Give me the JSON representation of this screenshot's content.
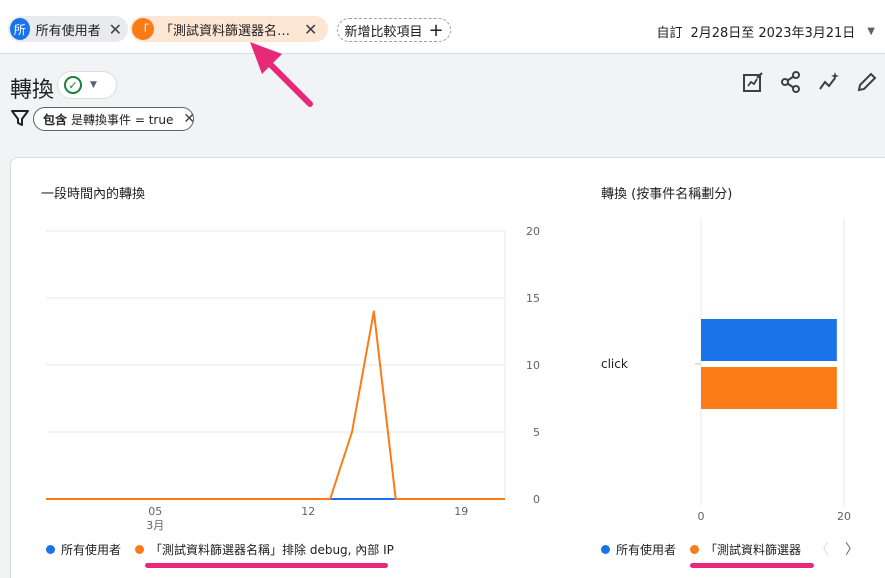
{
  "comparisons": [
    {
      "badge": "所",
      "label": "所有使用者",
      "color": "#1a73e8"
    },
    {
      "badge": "「",
      "label": "「測試資料篩選器名稱...",
      "color": "#fa7b17"
    }
  ],
  "add_comparison_label": "新增比較項目",
  "date": {
    "preset": "自訂",
    "range": "2月28日至 2023年3月21日"
  },
  "page": {
    "title": "轉換"
  },
  "filter": {
    "prefix": "包含",
    "text": "是轉換事件 = true"
  },
  "line_card": {
    "title": "一段時間內的轉換"
  },
  "bar_card": {
    "title": "轉換 (按事件名稱劃分)"
  },
  "legend_line": [
    "所有使用者",
    "「測試資料篩選器名稱」排除 debug, 內部 IP"
  ],
  "legend_bar": [
    "所有使用者",
    "「測試資料篩選器"
  ],
  "colors": {
    "series_blue": "#1a73e8",
    "series_orange": "#fa7b17",
    "annotation": "#e8297a"
  },
  "icons": [
    "customize-report-icon",
    "share-icon",
    "insights-icon",
    "edit-icon",
    "filter-icon",
    "check-circle-icon",
    "close-icon",
    "plus-icon",
    "chevron-right-icon",
    "chevron-left-icon"
  ],
  "chart_data": [
    {
      "type": "line",
      "title": "一段時間內的轉換",
      "x": [
        "2月28日",
        "3月1日",
        "3月2日",
        "3月3日",
        "3月4日",
        "3月5日",
        "3月6日",
        "3月7日",
        "3月8日",
        "3月9日",
        "3月10日",
        "3月11日",
        "3月12日",
        "3月13日",
        "3月14日",
        "3月15日",
        "3月16日",
        "3月17日",
        "3月18日",
        "3月19日",
        "3月20日",
        "3月21日"
      ],
      "x_ticks": [
        {
          "label": "05",
          "sub": "3月",
          "index": 5
        },
        {
          "label": "12",
          "sub": "",
          "index": 12
        },
        {
          "label": "19",
          "sub": "",
          "index": 19
        }
      ],
      "series": [
        {
          "name": "所有使用者",
          "values": [
            0,
            0,
            0,
            0,
            0,
            0,
            0,
            0,
            0,
            0,
            0,
            0,
            0,
            0,
            0,
            0,
            0,
            0,
            0,
            0,
            0,
            0
          ]
        },
        {
          "name": "「測試資料篩選器名稱」排除 debug, 內部 IP",
          "values": [
            0,
            0,
            0,
            0,
            0,
            0,
            0,
            0,
            0,
            0,
            0,
            0,
            0,
            0,
            5,
            14,
            0,
            0,
            0,
            0,
            0,
            0
          ]
        }
      ],
      "y_ticks": [
        0,
        5,
        10,
        15,
        20
      ],
      "ylim": [
        0,
        20
      ],
      "grid": true
    },
    {
      "type": "bar",
      "title": "轉換 (按事件名稱劃分)",
      "categories": [
        "click"
      ],
      "series": [
        {
          "name": "所有使用者",
          "values": [
            19
          ]
        },
        {
          "name": "「測試資料篩選器名稱」排除 debug, 內部 IP",
          "values": [
            19
          ]
        }
      ],
      "x_ticks": [
        0,
        20
      ],
      "xlim": [
        0,
        20
      ],
      "orientation": "horizontal"
    }
  ]
}
